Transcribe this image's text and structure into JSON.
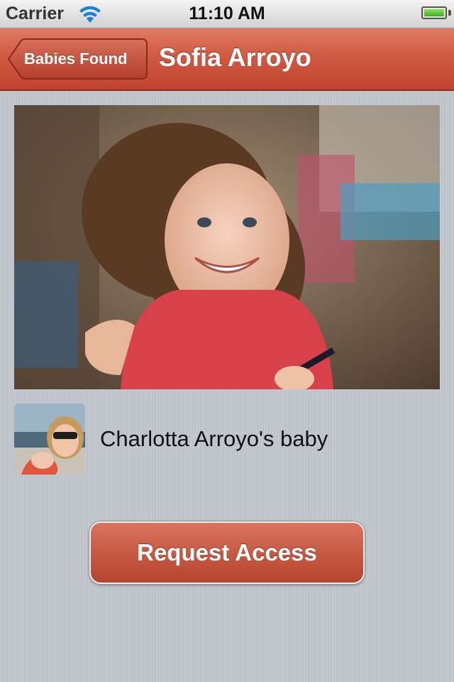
{
  "status_bar": {
    "carrier": "Carrier",
    "time": "11:10 AM",
    "battery_level": 1.0,
    "battery_color": "#3fae1f"
  },
  "nav_bar": {
    "back_label": "Babies Found",
    "title": "Sofia Arroyo",
    "color": "#c8503a"
  },
  "photo": {
    "icon": "baby-photo"
  },
  "parent": {
    "name": "Charlotta Arroyo's baby",
    "icon": "parent-avatar"
  },
  "actions": {
    "request_label": "Request Access",
    "color": "#c85a44"
  }
}
